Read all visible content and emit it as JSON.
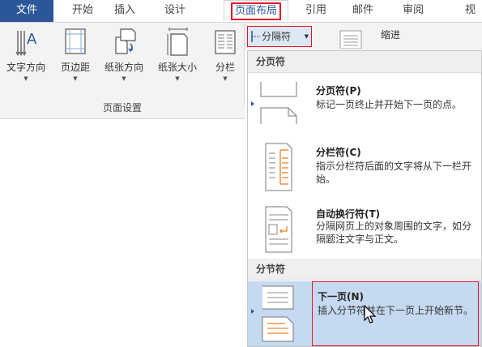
{
  "tabs": [
    "文件",
    "开始",
    "插入",
    "设计",
    "页面布局",
    "引用",
    "邮件",
    "审阅",
    "视"
  ],
  "ribbon": {
    "buttons": [
      "文字方向",
      "页边距",
      "纸张方向",
      "纸张大小",
      "分栏"
    ],
    "group_label": "页面设置",
    "breaks_label": "分隔符",
    "indent_label": "缩进"
  },
  "menu": {
    "page_breaks_header": "分页符",
    "section_breaks_header": "分节符",
    "items": [
      {
        "title": "分页符(P)",
        "desc": "标记一页终止并开始下一页的点。"
      },
      {
        "title": "分栏符(C)",
        "desc": "指示分栏符后面的文字将从下一栏开始。"
      },
      {
        "title": "自动换行符(T)",
        "desc": "分隔网页上的对象周围的文字，如分隔题注文字与正文。"
      },
      {
        "title": "下一页(N)",
        "desc": "插入分节符并在下一页上开始新节。"
      }
    ]
  },
  "colors": {
    "file_tab": "#2b579a",
    "highlight": "#c5d9f1",
    "red_outline": "#e81123",
    "accent_orange": "#e8822a"
  }
}
